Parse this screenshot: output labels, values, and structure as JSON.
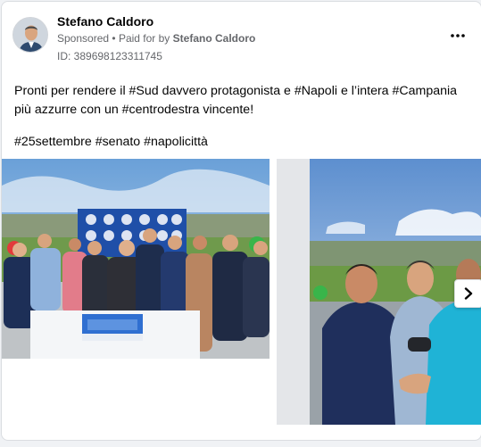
{
  "advertiser": {
    "name": "Stefano Caldoro",
    "sponsored_label": "Sponsored",
    "separator": "•",
    "paid_for_prefix": "Paid for by",
    "paid_for_name": "Stefano Caldoro",
    "ad_id": "ID: 389698123311745"
  },
  "post": {
    "text": "Pronti per rendere il #Sud davvero protagonista e #Napoli e l’intera #Campania più azzurre con un #centrodestra vincente!",
    "hashtags": "#25settembre #senato #napolicittà"
  },
  "carousel": {
    "images": [
      "group-photo-cake-cutting",
      "handshake-photo"
    ]
  },
  "icons": {
    "more": "more-options-icon",
    "next": "chevron-right-icon"
  },
  "colors": {
    "primary_text": "#050505",
    "secondary_text": "#65676b",
    "card_background": "#ffffff",
    "page_background": "#f0f2f5"
  }
}
